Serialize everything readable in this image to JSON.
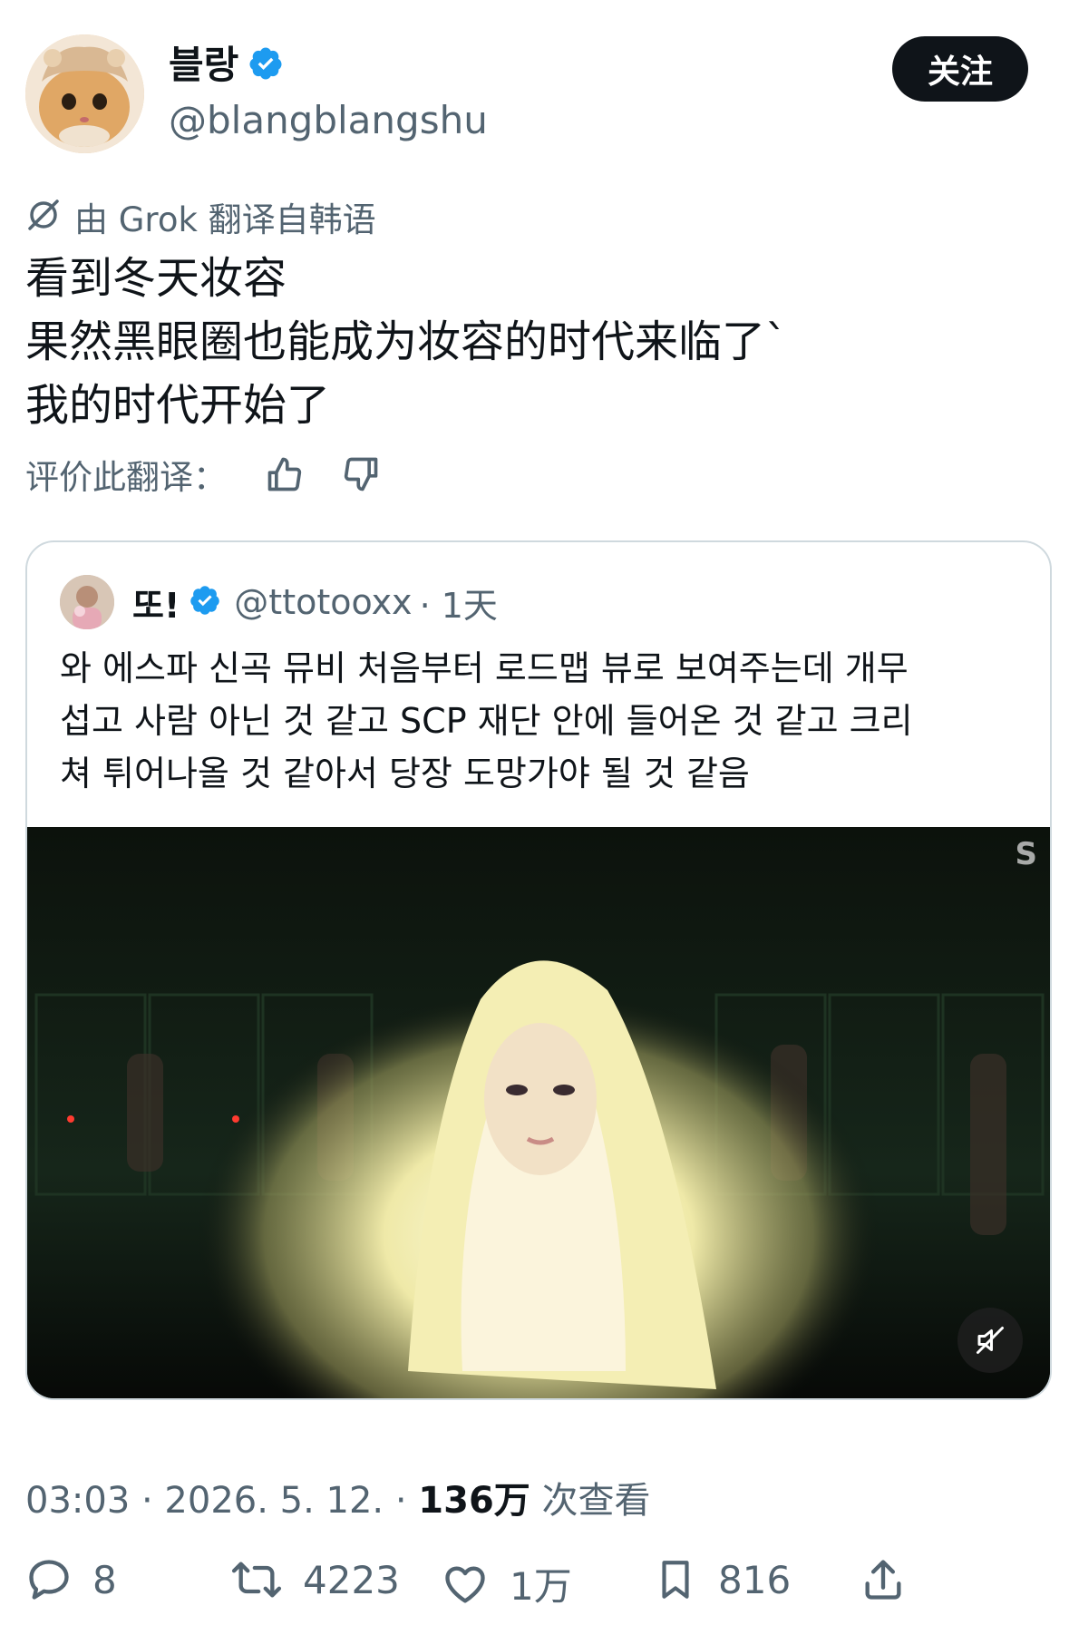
{
  "author": {
    "display_name": "블랑",
    "handle": "@blangblangshu",
    "verified": true,
    "follow_label": "关注"
  },
  "translation": {
    "label": "由 Grok 翻译自韩语",
    "icon": "grok-icon",
    "rate_label": "评价此翻译："
  },
  "tweet": {
    "lines": [
      "看到冬天妆容",
      "果然黑眼圈也能成为妆容的时代来临了`",
      "我的时代开始了"
    ]
  },
  "quote": {
    "display_name": "또!",
    "handle": "@ttotooxx",
    "time": "· 1天",
    "verified": true,
    "lines": [
      "와 에스파 신곡 뮤비 처음부터 로드맵 뷰로 보여주는데 개무",
      "섭고 사람 아닌 것 같고 SCP 재단 안에 들어온 것 같고 크리",
      "쳐 튀어나올 것 같아서 당장 도망가야 될 것 같음"
    ],
    "media_watermark": "S"
  },
  "meta": {
    "time_date": "03:03 · 2026. 5. 12. · ",
    "views_count": "136万",
    "views_label": " 次查看"
  },
  "actions": {
    "replies": "8",
    "retweets": "4223",
    "likes": "1万",
    "bookmarks": "816"
  },
  "colors": {
    "text_primary": "#0f1419",
    "text_secondary": "#536471",
    "verified_blue": "#1d9bf0",
    "border": "#cfd9de"
  }
}
